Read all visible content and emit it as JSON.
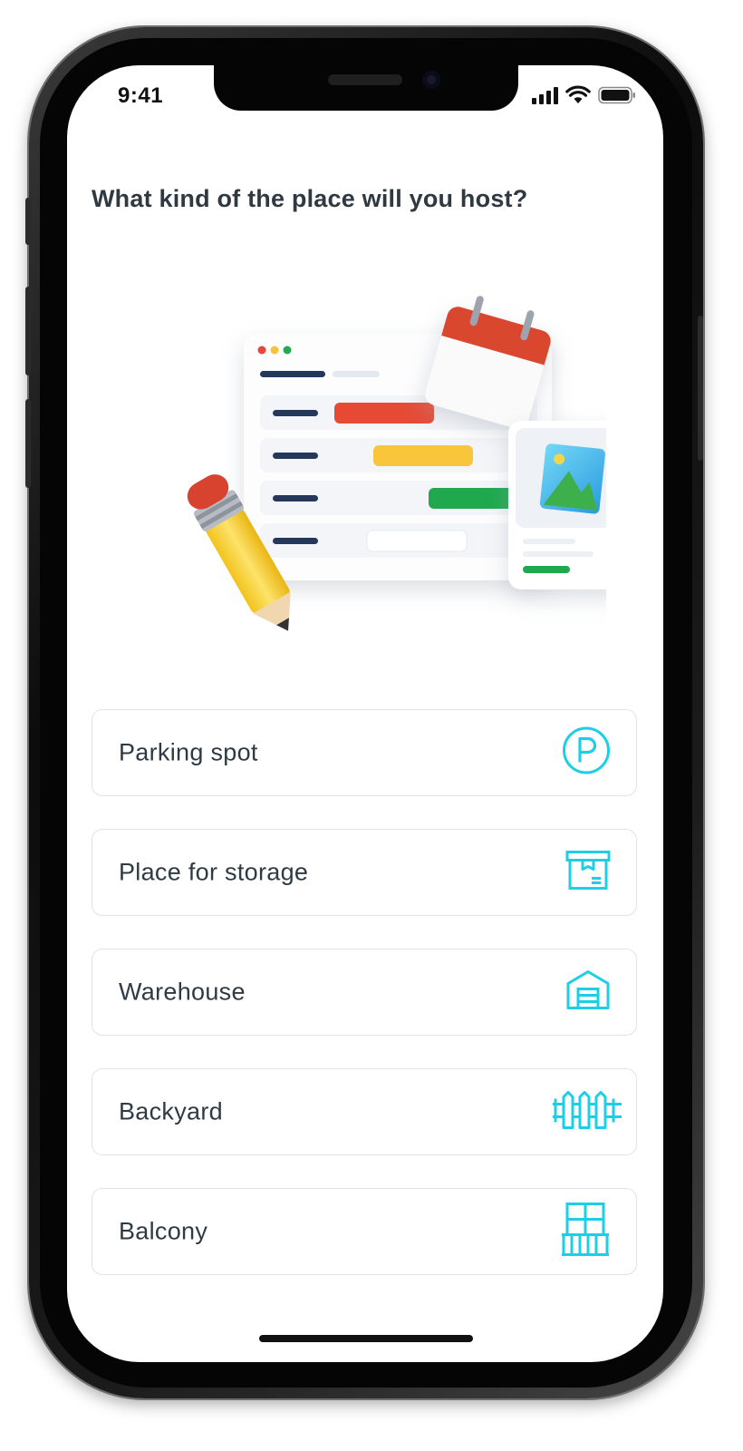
{
  "status_bar": {
    "time": "9:41",
    "icons": [
      "cellular-signal-icon",
      "wifi-icon",
      "battery-icon"
    ]
  },
  "question": "What kind of the place will you host?",
  "options": [
    {
      "label": "Parking spot",
      "icon": "parking-icon"
    },
    {
      "label": "Place for storage",
      "icon": "storage-box-icon"
    },
    {
      "label": "Warehouse",
      "icon": "warehouse-icon"
    },
    {
      "label": "Backyard",
      "icon": "fence-icon"
    },
    {
      "label": "Balcony",
      "icon": "balcony-icon"
    }
  ],
  "colors": {
    "accent": "#1ccfe6",
    "text": "#2e3a44",
    "border": "#dfe3e8"
  }
}
